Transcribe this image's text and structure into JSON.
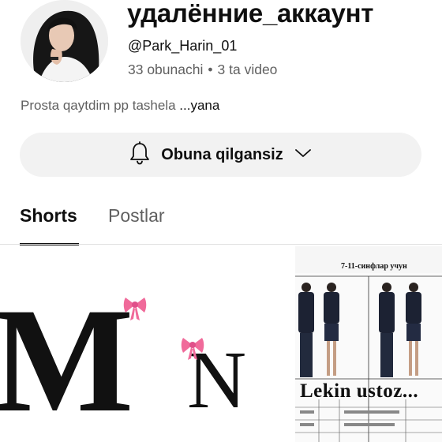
{
  "channel": {
    "title": "удалённие_аккаунт",
    "handle": "@Park_Harin_01",
    "subscribers": "33 obunachi",
    "separator": "•",
    "videos": "3 ta video",
    "description": "Prosta qaytdim pp tashela ",
    "description_more": "...yana"
  },
  "subscribe_button": {
    "label": "Obuna qilgansiz",
    "icon": "bell-icon",
    "dropdown_icon": "chevron-down-icon"
  },
  "tabs": [
    {
      "label": "Shorts",
      "active": true
    },
    {
      "label": "Postlar",
      "active": false
    }
  ],
  "shorts": [
    {
      "letter": "M"
    },
    {
      "letter": "N"
    },
    {
      "doc_title": "7-11-синфлар учун",
      "caption": "Lekin ustoz..."
    }
  ],
  "colors": {
    "text_primary": "#0f0f0f",
    "text_secondary": "#606060",
    "button_bg": "#f2f2f2",
    "bow_pink": "#f06a9a"
  }
}
